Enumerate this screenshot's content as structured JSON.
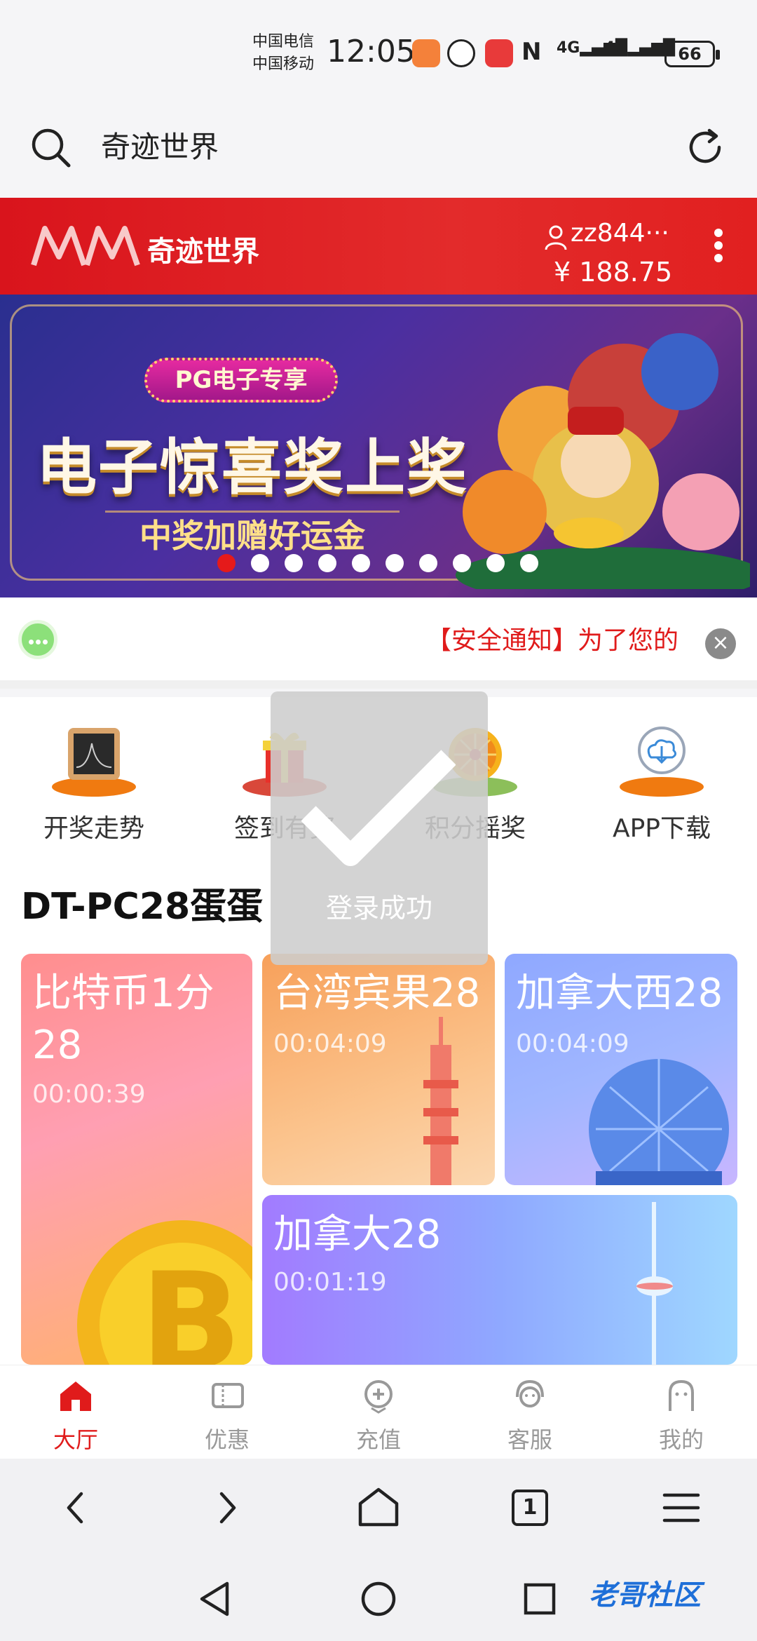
{
  "status_bar": {
    "carrier_1": "中国电信",
    "carrier_2": "中国移动",
    "time": "12:05",
    "net_1": "4G",
    "net_2": "4G",
    "battery": "66"
  },
  "browser": {
    "url_text": "奇迹世界"
  },
  "site_header": {
    "logo_text": "奇迹世界",
    "username": "zz844···",
    "balance": "¥ 188.75"
  },
  "banner": {
    "badge": "PG电子专享",
    "title": "电子惊喜奖上奖",
    "subtitle": "中奖加赠好运金",
    "active_slide": 1,
    "slide_count": 10
  },
  "notice": {
    "text": "【安全通知】为了您的",
    "close_symbol": "×"
  },
  "quick_menu": [
    {
      "label": "开奖走势",
      "icon": "trend-chart-icon"
    },
    {
      "label": "签到有奖",
      "icon": "gift-icon"
    },
    {
      "label": "积分摇奖",
      "icon": "lottery-wheel-icon"
    },
    {
      "label": "APP下载",
      "icon": "cloud-download-icon"
    }
  ],
  "section": {
    "title": "DT-PC28蛋蛋"
  },
  "games": [
    {
      "name": "比特币1分28",
      "name_line1": "比特币1分",
      "name_line2": "28",
      "countdown": "00:00:39"
    },
    {
      "name": "台湾宾果28",
      "countdown": "00:04:09"
    },
    {
      "name": "加拿大西28",
      "countdown": "00:04:09"
    },
    {
      "name": "加拿大28",
      "countdown": "00:01:19"
    }
  ],
  "toast": {
    "text": "登录成功"
  },
  "tabbar": [
    {
      "label": "大厅",
      "icon": "home-icon",
      "active": true
    },
    {
      "label": "优惠",
      "icon": "coupon-icon",
      "active": false
    },
    {
      "label": "充值",
      "icon": "recharge-icon",
      "active": false
    },
    {
      "label": "客服",
      "icon": "customer-service-icon",
      "active": false
    },
    {
      "label": "我的",
      "icon": "profile-icon",
      "active": false
    }
  ],
  "browser_nav": {
    "tab_count": "1"
  },
  "watermark": "老哥社区",
  "colors": {
    "brand_red": "#e01b1b",
    "header_red": "#d9141c"
  }
}
